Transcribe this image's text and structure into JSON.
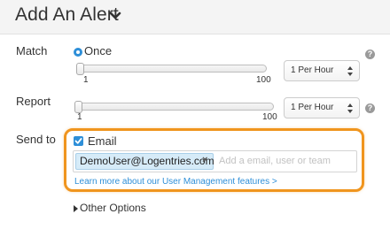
{
  "header": {
    "title": "Add An Alert"
  },
  "match": {
    "label": "Match",
    "option_label": "Once",
    "slider_min": "1",
    "slider_max": "100",
    "slider_value": 1,
    "select_value": "1 Per Hour"
  },
  "report": {
    "label": "Report",
    "slider_min": "1",
    "slider_max": "100",
    "slider_value": 1,
    "select_value": "1 Per Hour"
  },
  "send_to": {
    "label": "Send to",
    "email_checkbox_label": "Email",
    "email_checked": true,
    "recipients": [
      "DemoUser@Logentries.com"
    ],
    "tag_remove": "×",
    "input_placeholder": "Add a email, user or team",
    "learn_more_link": "Learn more about our User Management features >"
  },
  "other_options": {
    "label": "Other Options"
  },
  "help_icon": "?",
  "colors": {
    "accent": "#2e8fd8",
    "highlight": "#f0951e",
    "tag_bg": "#d6ebf8"
  }
}
